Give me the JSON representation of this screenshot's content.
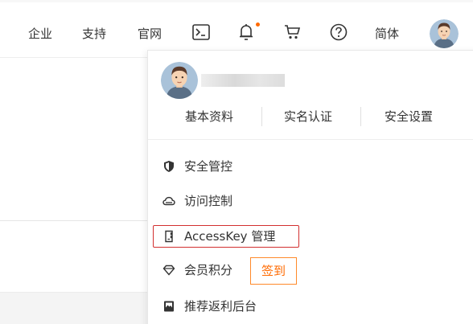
{
  "topnav": {
    "links": {
      "enterprise": "企业",
      "support": "支持",
      "official_site": "官网",
      "language": "简体"
    },
    "icons": [
      "terminal-icon",
      "bell-icon",
      "cart-icon",
      "help-icon"
    ],
    "has_notification": true,
    "accent": "#ff6a00"
  },
  "user_menu": {
    "username": "",
    "tabs": [
      "基本资料",
      "实名认证",
      "安全设置"
    ],
    "items": [
      {
        "label": "安全管控",
        "icon": "shield-icon"
      },
      {
        "label": "访问控制",
        "icon": "cloud-icon"
      },
      {
        "label": "AccessKey 管理",
        "icon": "key-icon"
      },
      {
        "label": "会员积分",
        "icon": "diamond-icon"
      },
      {
        "label": "推荐返利后台",
        "icon": "gift-icon"
      }
    ],
    "checkin_label": "签到",
    "active_item": "AccessKey 管理",
    "highlight_color": "#d23030"
  }
}
